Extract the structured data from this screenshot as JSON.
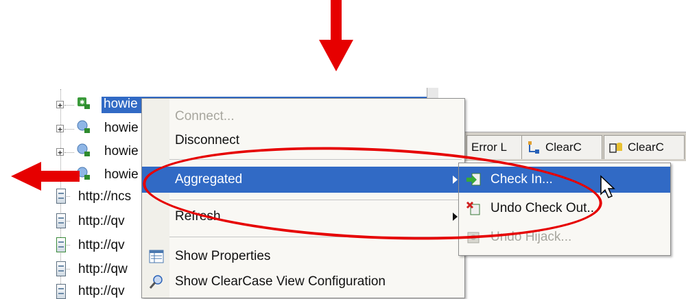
{
  "tree": {
    "nodes": [
      {
        "label": "howie",
        "selected": true
      },
      {
        "label": "howie"
      },
      {
        "label": "howie"
      },
      {
        "label": "howie"
      }
    ],
    "urls": [
      "http://ncs",
      "http://qv",
      "http://qv",
      "http://qw",
      "http://qv"
    ],
    "selected_overflow_text": "howie"
  },
  "tabs": [
    {
      "label": "Error L",
      "icon": "error-log-icon"
    },
    {
      "label": "ClearC",
      "icon": "clearcase-tree-icon"
    },
    {
      "label": "ClearC",
      "icon": "clearcase-db-icon"
    }
  ],
  "context_menu": {
    "items": [
      {
        "label": "Connect...",
        "enabled": false
      },
      {
        "label": "Disconnect",
        "enabled": true
      },
      {
        "label": "Aggregated",
        "enabled": true,
        "highlighted": true,
        "has_submenu": true
      },
      {
        "label": "Refresh",
        "enabled": true,
        "has_submenu": true
      },
      {
        "label": "Show Properties",
        "enabled": true,
        "icon": "properties-icon"
      },
      {
        "label": "Show ClearCase View Configuration",
        "enabled": true,
        "icon": "view-config-icon"
      }
    ]
  },
  "submenu": {
    "items": [
      {
        "label": "Check In...",
        "enabled": true,
        "highlighted": true,
        "icon": "check-in-icon"
      },
      {
        "label": "Undo Check Out...",
        "enabled": true,
        "icon": "undo-checkout-icon"
      },
      {
        "label": "Undo Hijack...",
        "enabled": false,
        "icon": "undo-hijack-icon"
      }
    ]
  },
  "colors": {
    "highlight": "#316ac5",
    "annotation": "#e60000",
    "menu_bg": "#f9f8f4"
  }
}
